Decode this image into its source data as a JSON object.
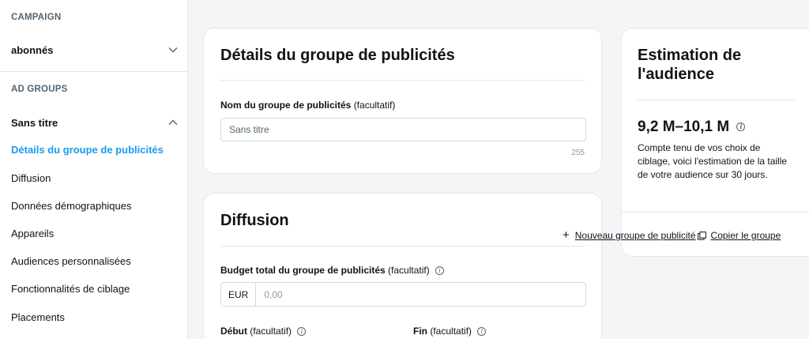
{
  "sidebar": {
    "campaign_section": "CAMPAIGN",
    "campaign_name": "abonnés",
    "adgroups_section": "AD GROUPS",
    "adgroup_name": "Sans titre",
    "nav": [
      {
        "label": "Détails du groupe de publicités",
        "active": true
      },
      {
        "label": "Diffusion",
        "active": false
      },
      {
        "label": "Données démographiques",
        "active": false
      },
      {
        "label": "Appareils",
        "active": false
      },
      {
        "label": "Audiences personnalisées",
        "active": false
      },
      {
        "label": "Fonctionnalités de ciblage",
        "active": false
      },
      {
        "label": "Placements",
        "active": false
      }
    ]
  },
  "details": {
    "title": "Détails du groupe de publicités",
    "name_label": "Nom du groupe de publicités",
    "name_optional": "(facultatif)",
    "name_placeholder": "Sans titre",
    "char_count": "255"
  },
  "delivery": {
    "title": "Diffusion",
    "budget_label": "Budget total du groupe de publicités",
    "budget_optional": "(facultatif)",
    "currency": "EUR",
    "budget_placeholder": "0,00",
    "start_label": "Début",
    "start_optional": "(facultatif)",
    "end_label": "Fin",
    "end_optional": "(facultatif)"
  },
  "audience": {
    "title": "Estimation de l'audience",
    "value": "9,2 M–10,1 M",
    "description": "Compte tenu de vos choix de ciblage, voici l'estimation de la taille de votre audience sur 30 jours."
  },
  "actions": {
    "new_group": "Nouveau groupe de publicité",
    "copy_group": "Copier le groupe"
  },
  "icons": {
    "info": "info-icon",
    "chevron_down": "chevron-down-icon",
    "chevron_up": "chevron-up-icon",
    "plus": "plus-icon",
    "copy": "copy-icon"
  },
  "colors": {
    "accent": "#1d9bf0",
    "text": "#0f1419",
    "muted": "#536471",
    "background": "#f4f5f6"
  }
}
